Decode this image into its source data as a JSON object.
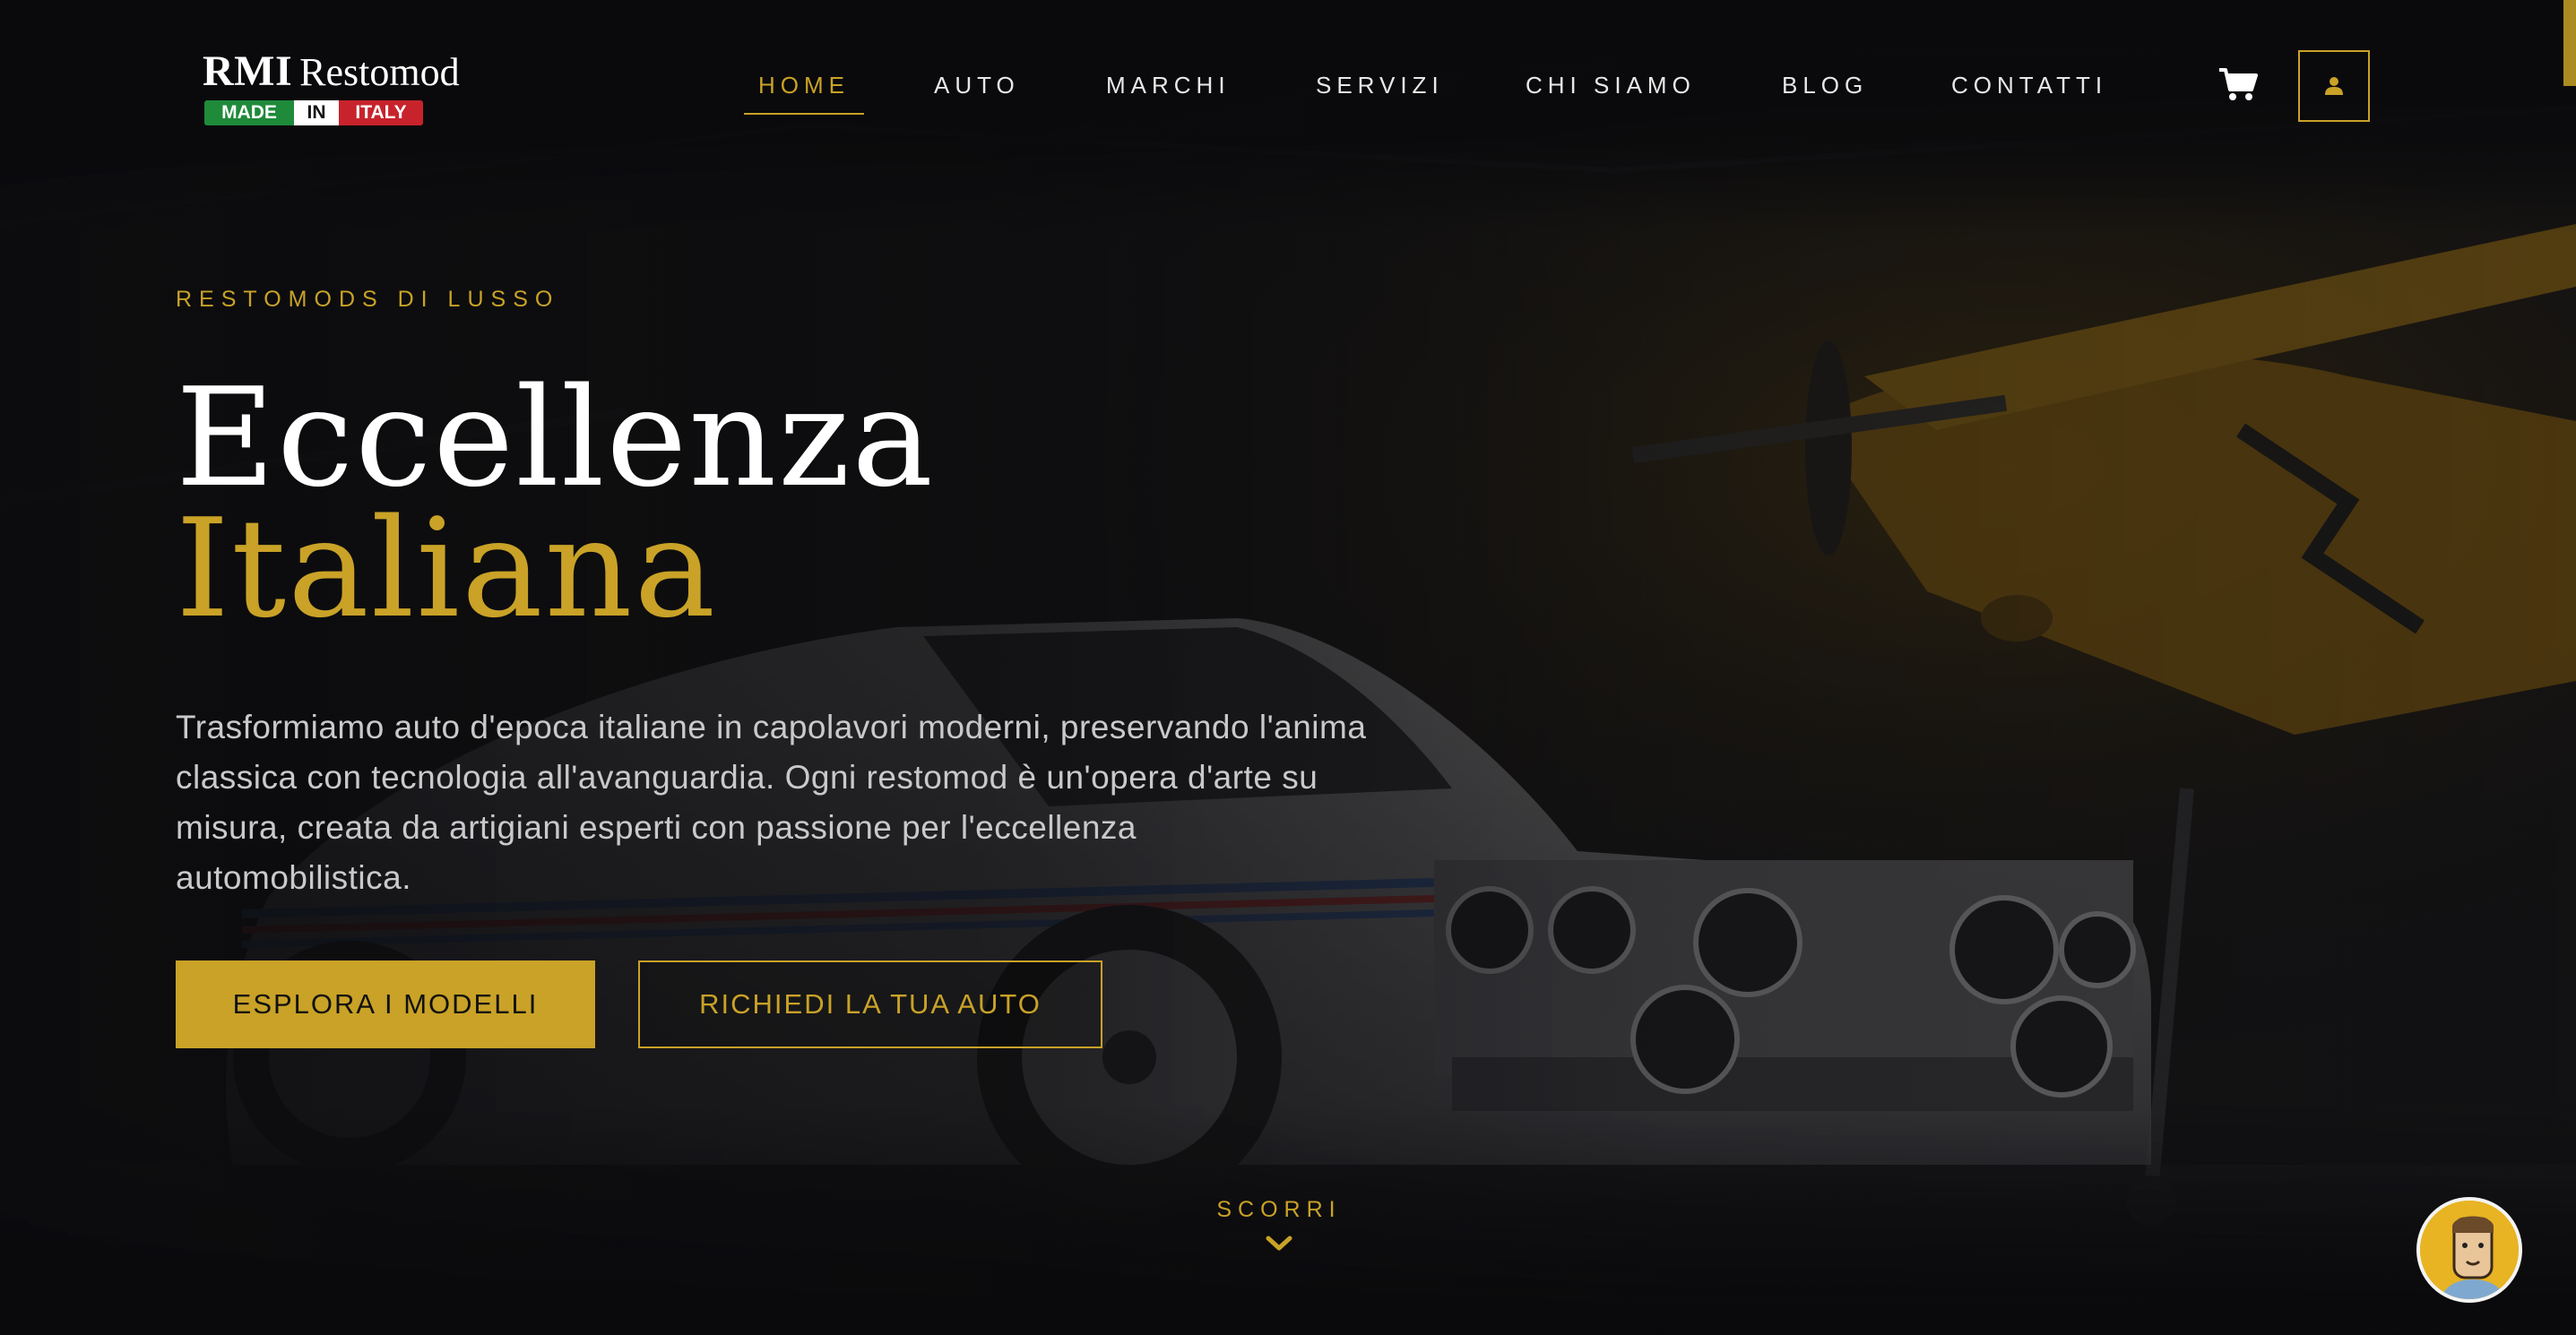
{
  "brand": {
    "name_bold": "RMI",
    "name_regular": "Restomod",
    "flag_made": "MADE",
    "flag_in": "IN",
    "flag_italy": "ITALY"
  },
  "nav": {
    "items": [
      {
        "label": "HOME",
        "active": true
      },
      {
        "label": "AUTO",
        "active": false
      },
      {
        "label": "MARCHI",
        "active": false
      },
      {
        "label": "SERVIZI",
        "active": false
      },
      {
        "label": "CHI SIAMO",
        "active": false
      },
      {
        "label": "BLOG",
        "active": false
      },
      {
        "label": "CONTATTI",
        "active": false
      }
    ]
  },
  "header_icons": {
    "cart": "cart-icon",
    "account": "user-icon"
  },
  "hero": {
    "eyebrow": "RESTOMODS DI LUSSO",
    "title_line1": "Eccellenza",
    "title_line2": "Italiana",
    "lead": "Trasformiamo auto d'epoca italiane in capolavori moderni, preservando l'anima classica con tecnologia all'avanguardia. Ogni restomod è un'opera d'arte su misura, creata da artigiani esperti con passione per l'eccellenza automobilistica.",
    "cta_primary": "ESPLORA I MODELLI",
    "cta_secondary": "RICHIEDI LA TUA AUTO",
    "scroll_label": "SCORRI"
  },
  "colors": {
    "accent": "#c9a227",
    "background": "#0d0d0f",
    "text": "#ffffff",
    "muted_text": "#c9c9cc"
  }
}
